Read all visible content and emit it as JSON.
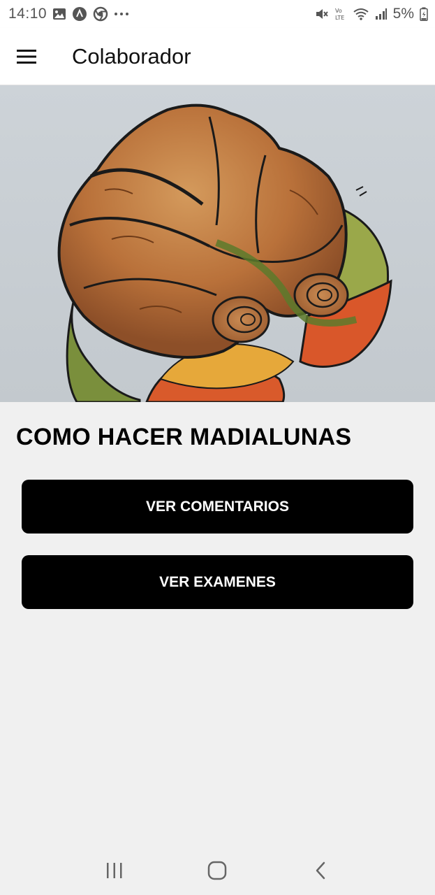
{
  "status_bar": {
    "time": "14:10",
    "left_icons": [
      "image-icon",
      "app-icon",
      "chrome-icon",
      "more-dots-icon"
    ],
    "right_icons": [
      "mute-icon",
      "volte-icon",
      "wifi-icon",
      "signal-icon"
    ],
    "battery": "5%"
  },
  "app_bar": {
    "title": "Colaborador",
    "menu_icon": "hamburger-menu-icon"
  },
  "hero_image": {
    "subject": "croissant-watercolor-illustration"
  },
  "course": {
    "title": "COMO HACER MADIALUNAS"
  },
  "buttons": {
    "comments_label": "VER COMENTARIOS",
    "exams_label": "VER EXAMENES"
  },
  "nav_bar": {
    "icons": [
      "recent-apps-icon",
      "home-icon",
      "back-icon"
    ]
  },
  "colors": {
    "button_bg": "#000000",
    "button_text": "#ffffff",
    "background": "#f0f0f0",
    "app_bar_bg": "#ffffff"
  }
}
